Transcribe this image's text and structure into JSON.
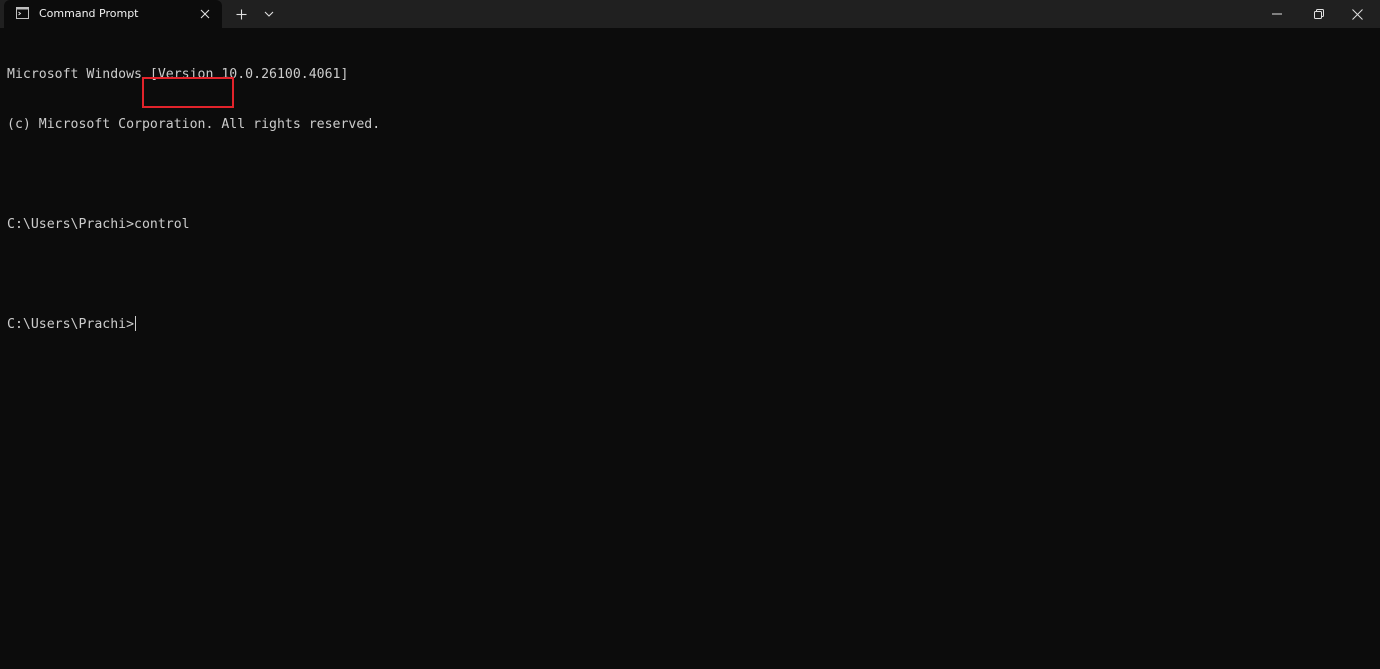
{
  "tab": {
    "title": "Command Prompt"
  },
  "console": {
    "lines": [
      "Microsoft Windows [Version 10.0.26100.4061]",
      "(c) Microsoft Corporation. All rights reserved.",
      "",
      "C:\\Users\\Prachi>control",
      "",
      "C:\\Users\\Prachi>"
    ],
    "prompt": "C:\\Users\\Prachi>",
    "command": "control"
  },
  "colors": {
    "background": "#0c0c0c",
    "titlebar": "#202020",
    "text": "#cccccc",
    "highlight": "#e3232b"
  },
  "icons": {
    "tab": "terminal-icon",
    "close_tab": "close-icon",
    "new_tab": "plus-icon",
    "dropdown": "chevron-down-icon",
    "minimize": "minimize-icon",
    "restore": "restore-icon",
    "close_window": "close-icon"
  }
}
